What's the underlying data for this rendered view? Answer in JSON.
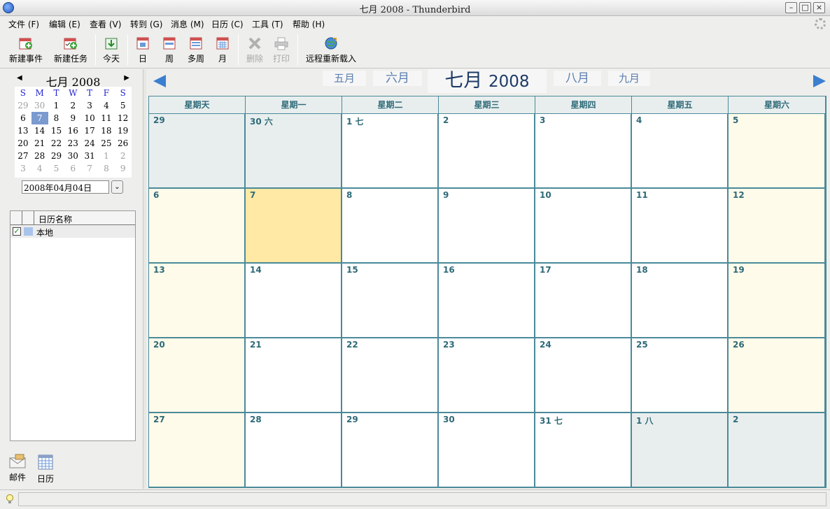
{
  "window": {
    "title": "七月 2008 - Thunderbird",
    "min": "–",
    "max": "□",
    "close": "×"
  },
  "menu": [
    "文件 (F)",
    "编辑 (E)",
    "查看 (V)",
    "转到 (G)",
    "消息 (M)",
    "日历 (C)",
    "工具 (T)",
    "帮助 (H)"
  ],
  "toolbar": {
    "new_event": "新建事件",
    "new_task": "新建任务",
    "today": "今天",
    "day": "日",
    "week": "周",
    "multiweek": "多周",
    "month": "月",
    "delete": "删除",
    "print": "打印",
    "reload": "远程重新载入"
  },
  "minical": {
    "title": "七月 2008",
    "prev": "◀",
    "next": "▶",
    "dow": [
      "S",
      "M",
      "T",
      "W",
      "T",
      "F",
      "S"
    ],
    "weeks": [
      [
        "29",
        "30",
        "1",
        "2",
        "3",
        "4",
        "5"
      ],
      [
        "6",
        "7",
        "8",
        "9",
        "10",
        "11",
        "12"
      ],
      [
        "13",
        "14",
        "15",
        "16",
        "17",
        "18",
        "19"
      ],
      [
        "20",
        "21",
        "22",
        "23",
        "24",
        "25",
        "26"
      ],
      [
        "27",
        "28",
        "29",
        "30",
        "31",
        "1",
        "2"
      ],
      [
        "3",
        "4",
        "5",
        "6",
        "7",
        "8",
        "9"
      ]
    ]
  },
  "date_field": {
    "value": "2008年04月04日",
    "drop": "⌄"
  },
  "calendar_list": {
    "header": "日历名称",
    "items": [
      {
        "name": "本地",
        "checked": "✓",
        "color": "#a8c4ec"
      }
    ]
  },
  "modes": {
    "mail": "邮件",
    "calendar": "日历"
  },
  "month_nav": {
    "prev2": "五月",
    "prev1": "六月",
    "current_month": "七月",
    "current_year": "2008",
    "next1": "八月",
    "next2": "九月"
  },
  "dow_headers": [
    "星期天",
    "星期一",
    "星期二",
    "星期三",
    "星期四",
    "星期五",
    "星期六"
  ],
  "weeks": [
    [
      "29",
      "30 六",
      "1 七",
      "2",
      "3",
      "4",
      "5"
    ],
    [
      "6",
      "7",
      "8",
      "9",
      "10",
      "11",
      "12"
    ],
    [
      "13",
      "14",
      "15",
      "16",
      "17",
      "18",
      "19"
    ],
    [
      "20",
      "21",
      "22",
      "23",
      "24",
      "25",
      "26"
    ],
    [
      "27",
      "28",
      "29",
      "30",
      "31 七",
      "1 八",
      "2"
    ]
  ],
  "colors": {
    "weekend": "#fffbea",
    "other_month": "#e8eeee",
    "today": "#ffe9a4",
    "grid": "#4a8a99",
    "accent": "#3a7fd0"
  }
}
